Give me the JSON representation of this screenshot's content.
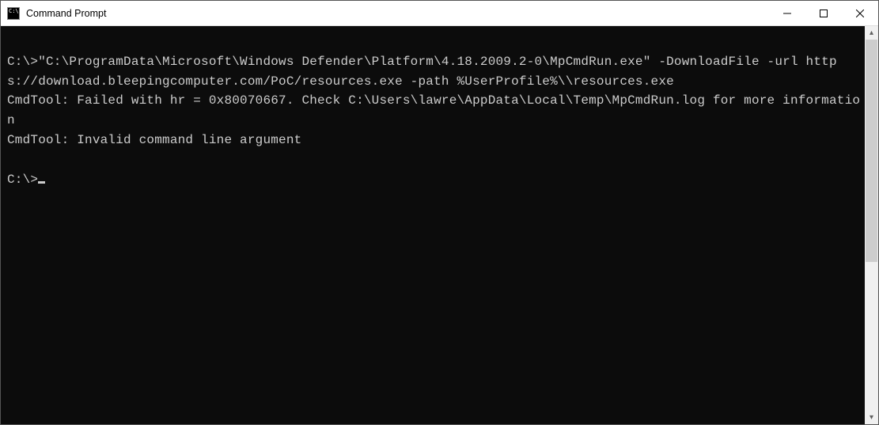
{
  "window": {
    "title": "Command Prompt"
  },
  "terminal": {
    "line1": "C:\\>\"C:\\ProgramData\\Microsoft\\Windows Defender\\Platform\\4.18.2009.2-0\\MpCmdRun.exe\" -DownloadFile -url https://download.bleepingcomputer.com/PoC/resources.exe -path %UserProfile%\\\\resources.exe",
    "line2": "CmdTool: Failed with hr = 0x80070667. Check C:\\Users\\lawre\\AppData\\Local\\Temp\\MpCmdRun.log for more information",
    "line3": "CmdTool: Invalid command line argument",
    "blank": "",
    "prompt": "C:\\>"
  },
  "scrollbar": {
    "up_glyph": "▴",
    "down_glyph": "▾"
  }
}
